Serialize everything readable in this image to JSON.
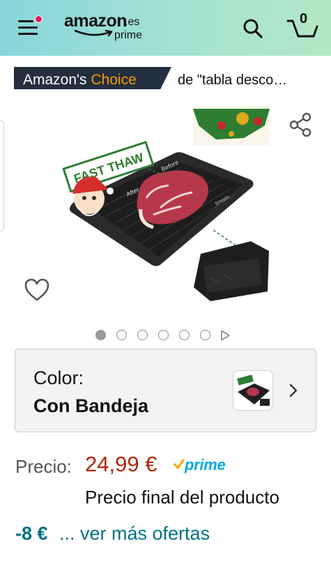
{
  "header": {
    "logo_main": "amazon",
    "logo_suffix": ".es",
    "logo_sub": "prime",
    "cart_count": "0",
    "accent_color": "#e8175d"
  },
  "badge": {
    "label_part1": "Amazon's",
    "label_part2": "Choice",
    "query": "de \"tabla desco…",
    "colors": {
      "background": "#232f3e",
      "choice": "#ff9900"
    }
  },
  "product_image": {
    "banner_text": "FAST THAW",
    "arrow_after": "After",
    "arrow_before": "Before",
    "brand_mark": "Smistin"
  },
  "carousel": {
    "total_dots": 6,
    "active_index": 0
  },
  "color_selector": {
    "label": "Color:",
    "value": "Con Bandeja"
  },
  "price": {
    "label": "Precio:",
    "value": "24,99 €",
    "prime_label": "prime",
    "final_note": "Precio final del producto",
    "discount": "-8 €",
    "more_offers": "... ver más ofertas",
    "colors": {
      "price": "#b12704",
      "prime": "#00a8e1",
      "link": "#007185"
    }
  }
}
